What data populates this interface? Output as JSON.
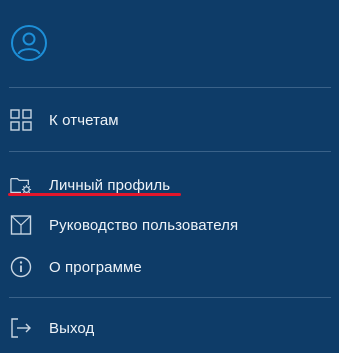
{
  "menu": {
    "items": [
      {
        "label": "К отчетам",
        "icon": "grid-icon"
      },
      {
        "label": "Личный профиль",
        "icon": "folder-settings-icon"
      },
      {
        "label": "Руководство пользователя",
        "icon": "manual-icon"
      },
      {
        "label": "О программе",
        "icon": "info-icon"
      },
      {
        "label": "Выход",
        "icon": "logout-icon"
      }
    ]
  },
  "colors": {
    "background": "#0e3c68",
    "accent": "#e3162b",
    "text": "#eef3f8",
    "divider": "#3a6289"
  }
}
